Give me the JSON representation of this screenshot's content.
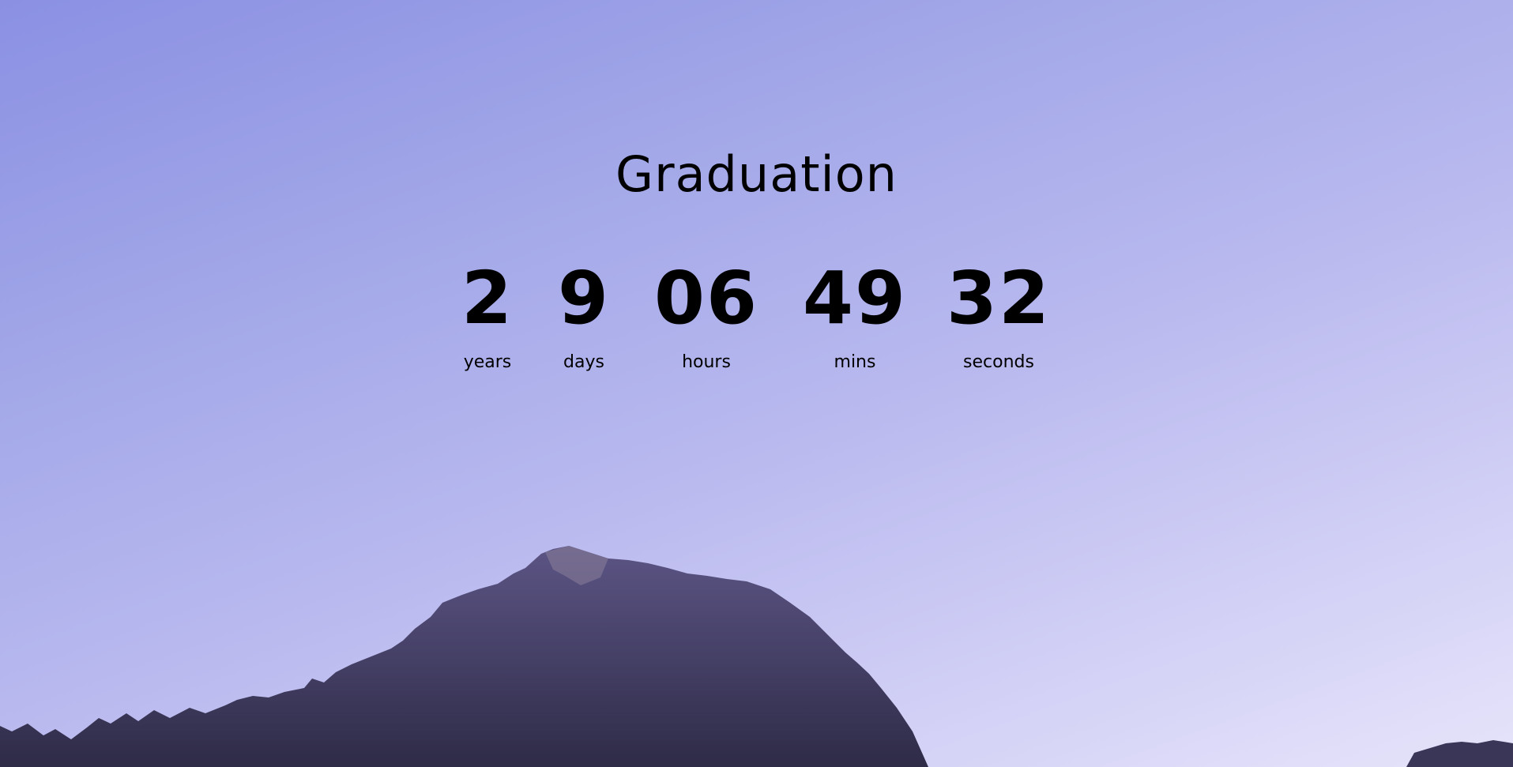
{
  "event": {
    "title": "Graduation"
  },
  "countdown": {
    "years": {
      "value": "2",
      "label": "years"
    },
    "days": {
      "value": "9",
      "label": "days"
    },
    "hours": {
      "value": "06",
      "label": "hours"
    },
    "mins": {
      "value": "49",
      "label": "mins"
    },
    "seconds": {
      "value": "32",
      "label": "seconds"
    }
  },
  "colors": {
    "sky_top": "#8b90e3",
    "sky_bottom": "#e6e4fa",
    "mountain": "#3e3a5e",
    "text": "#000000"
  }
}
